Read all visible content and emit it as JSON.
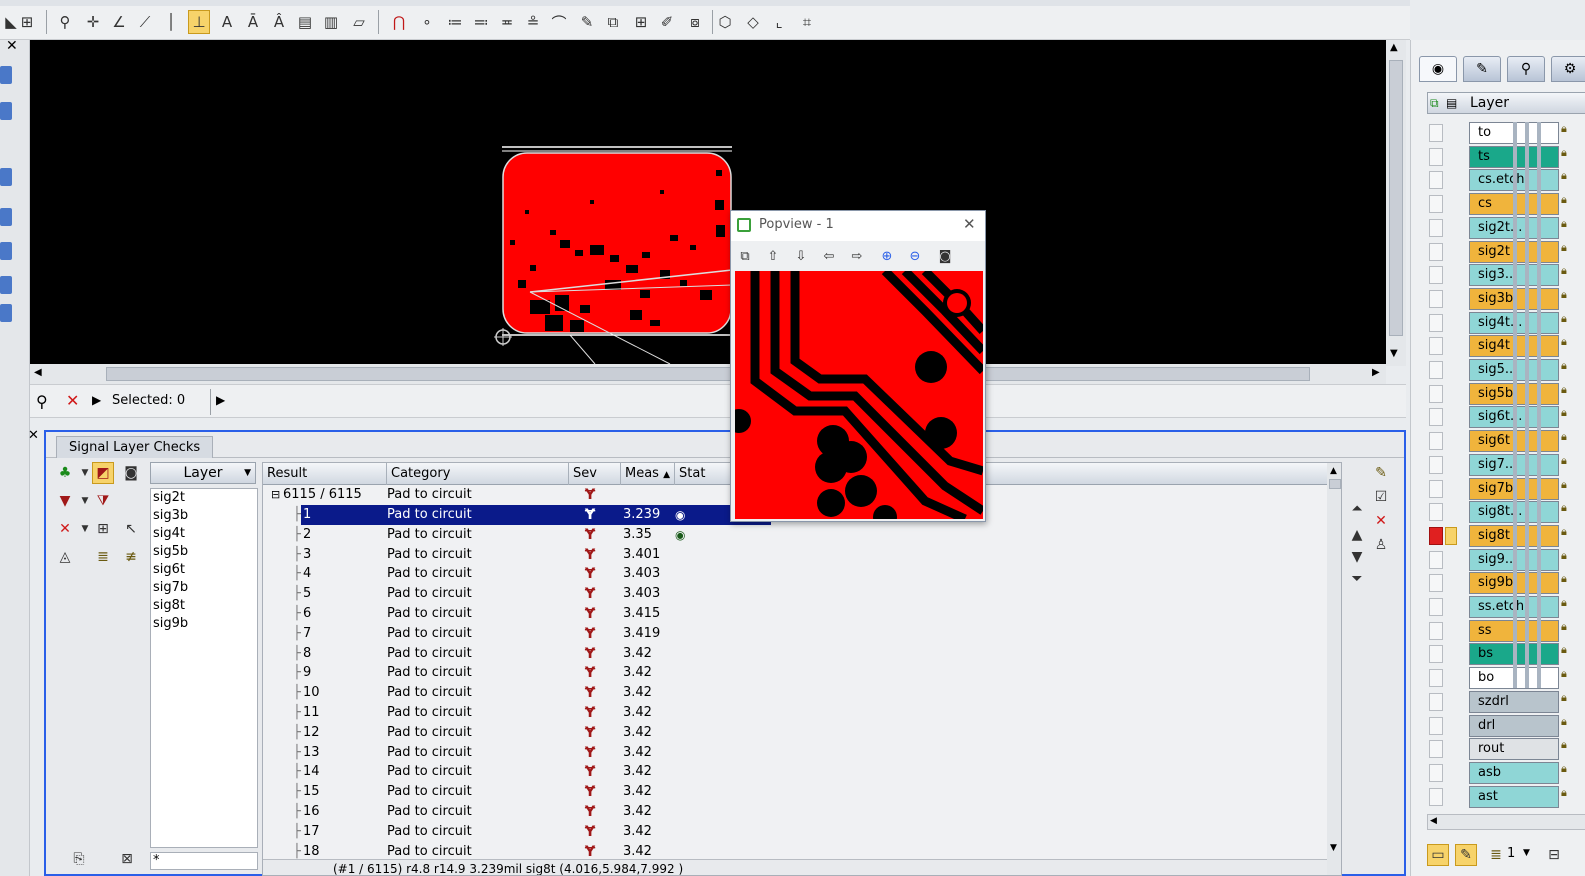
{
  "selection_bar": {
    "selected_text": "Selected: 0"
  },
  "panel": {
    "tab_label": "Signal Layer Checks",
    "layer_filter_header": "Layer",
    "layers": [
      "sig2t",
      "sig3b",
      "sig4t",
      "sig5b",
      "sig6t",
      "sig7b",
      "sig8t",
      "sig9b"
    ],
    "filter_value": "*",
    "columns": {
      "result": "Result",
      "category": "Category",
      "sev": "Sev",
      "meas": "Meas",
      "stat": "Stat"
    },
    "group_row": {
      "result": "6115 / 6115",
      "category": "Pad to circuit"
    },
    "rows": [
      {
        "result": "1",
        "category": "Pad to circuit",
        "meas": "3.239",
        "selected": true
      },
      {
        "result": "2",
        "category": "Pad to circuit",
        "meas": "3.35"
      },
      {
        "result": "3",
        "category": "Pad to circuit",
        "meas": "3.401"
      },
      {
        "result": "4",
        "category": "Pad to circuit",
        "meas": "3.403"
      },
      {
        "result": "5",
        "category": "Pad to circuit",
        "meas": "3.403"
      },
      {
        "result": "6",
        "category": "Pad to circuit",
        "meas": "3.415"
      },
      {
        "result": "7",
        "category": "Pad to circuit",
        "meas": "3.419"
      },
      {
        "result": "8",
        "category": "Pad to circuit",
        "meas": "3.42"
      },
      {
        "result": "9",
        "category": "Pad to circuit",
        "meas": "3.42"
      },
      {
        "result": "10",
        "category": "Pad to circuit",
        "meas": "3.42"
      },
      {
        "result": "11",
        "category": "Pad to circuit",
        "meas": "3.42"
      },
      {
        "result": "12",
        "category": "Pad to circuit",
        "meas": "3.42"
      },
      {
        "result": "13",
        "category": "Pad to circuit",
        "meas": "3.42"
      },
      {
        "result": "14",
        "category": "Pad to circuit",
        "meas": "3.42"
      },
      {
        "result": "15",
        "category": "Pad to circuit",
        "meas": "3.42"
      },
      {
        "result": "16",
        "category": "Pad to circuit",
        "meas": "3.42"
      },
      {
        "result": "17",
        "category": "Pad to circuit",
        "meas": "3.42"
      },
      {
        "result": "18",
        "category": "Pad to circuit",
        "meas": "3.42"
      }
    ],
    "status_text": "(#1 / 6115)  r4.8 r14.9  3.239mil  sig8t  (4.016,5.984,7.992 )"
  },
  "popview": {
    "title": "Popview - 1"
  },
  "layer_panel": {
    "header": "Layer",
    "layers": [
      {
        "name": "to",
        "color": "#ffffff",
        "checked": false
      },
      {
        "name": "ts",
        "color": "#1aa88a",
        "checked": false
      },
      {
        "name": "cs.etch",
        "color": "#8fd6d6",
        "checked": false
      },
      {
        "name": "cs",
        "color": "#f0b43c",
        "checked": false
      },
      {
        "name": "sig2t...",
        "color": "#8fd6d6",
        "checked": false
      },
      {
        "name": "sig2t",
        "color": "#f0b43c",
        "checked": false
      },
      {
        "name": "sig3...",
        "color": "#8fd6d6",
        "checked": false
      },
      {
        "name": "sig3b",
        "color": "#f0b43c",
        "checked": false
      },
      {
        "name": "sig4t...",
        "color": "#8fd6d6",
        "checked": false
      },
      {
        "name": "sig4t",
        "color": "#f0b43c",
        "checked": false
      },
      {
        "name": "sig5...",
        "color": "#8fd6d6",
        "checked": false
      },
      {
        "name": "sig5b",
        "color": "#f0b43c",
        "checked": false
      },
      {
        "name": "sig6t...",
        "color": "#8fd6d6",
        "checked": false
      },
      {
        "name": "sig6t",
        "color": "#f0b43c",
        "checked": false
      },
      {
        "name": "sig7...",
        "color": "#8fd6d6",
        "checked": false
      },
      {
        "name": "sig7b",
        "color": "#f0b43c",
        "checked": false
      },
      {
        "name": "sig8t...",
        "color": "#8fd6d6",
        "checked": false
      },
      {
        "name": "sig8t",
        "color": "#f0b43c",
        "checked": true
      },
      {
        "name": "sig9...",
        "color": "#8fd6d6",
        "checked": false
      },
      {
        "name": "sig9b",
        "color": "#f0b43c",
        "checked": false
      },
      {
        "name": "ss.etch",
        "color": "#8fd6d6",
        "checked": false
      },
      {
        "name": "ss",
        "color": "#f0b43c",
        "checked": false
      },
      {
        "name": "bs",
        "color": "#1aa88a",
        "checked": false
      },
      {
        "name": "bo",
        "color": "#ffffff",
        "checked": false
      },
      {
        "name": "szdrl",
        "color": "#b8c4cc",
        "checked": false
      },
      {
        "name": "drl",
        "color": "#b8c4cc",
        "checked": false
      },
      {
        "name": "rout",
        "color": "#dfe2e5",
        "checked": false
      },
      {
        "name": "asb",
        "color": "#8fd6d6",
        "checked": false
      },
      {
        "name": "ast",
        "color": "#8fd6d6",
        "checked": false
      }
    ],
    "bottom_count": "1"
  }
}
